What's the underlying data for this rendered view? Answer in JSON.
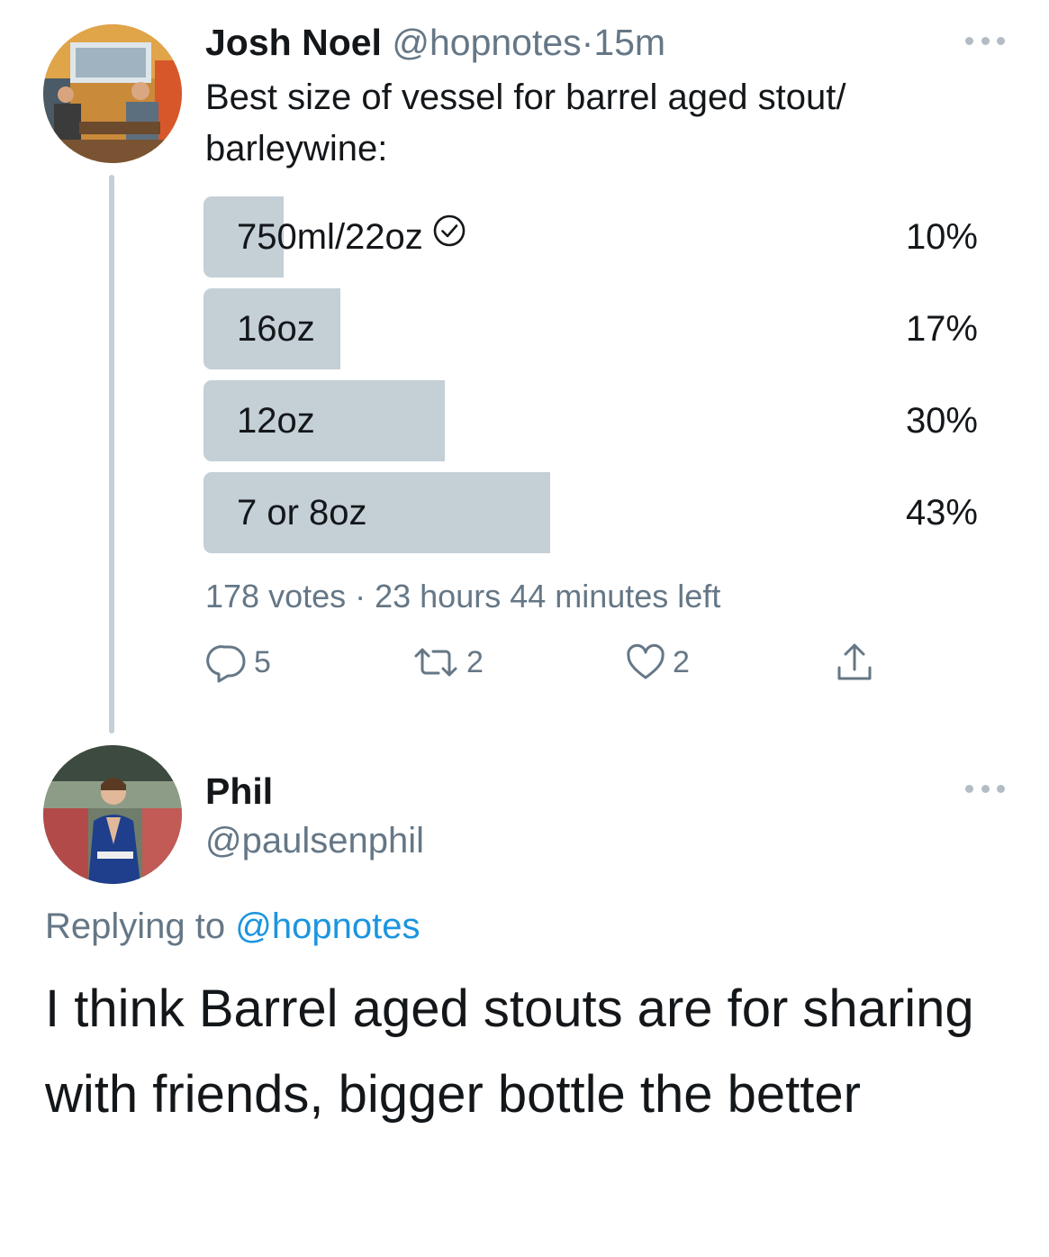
{
  "tweet": {
    "author_name": "Josh Noel",
    "author_handle": "@hopnotes",
    "separator": "·",
    "time": "15m",
    "text": "Best size of vessel for barrel aged stout/ barleywine:",
    "poll": {
      "options": [
        {
          "label": "750ml/22oz",
          "percent_text": "10%",
          "percent": 10,
          "voted": true
        },
        {
          "label": "16oz",
          "percent_text": "17%",
          "percent": 17,
          "voted": false
        },
        {
          "label": "12oz",
          "percent_text": "30%",
          "percent": 30,
          "voted": false
        },
        {
          "label": "7 or 8oz",
          "percent_text": "43%",
          "percent": 43,
          "voted": false
        }
      ],
      "meta": "178 votes · 23 hours 44 minutes left"
    },
    "actions": {
      "reply_count": "5",
      "retweet_count": "2",
      "like_count": "2"
    }
  },
  "reply": {
    "author_name": "Phil",
    "author_handle": "@paulsenphil",
    "replying_label": "Replying to",
    "replying_to": "@hopnotes",
    "text": "I think Barrel aged stouts are for sharing with friends, bigger bottle the better"
  },
  "colors": {
    "poll_bar": "#c4cfd6",
    "secondary_text": "#657786",
    "link": "#1b95e0"
  },
  "icons": [
    "more-icon",
    "check-circle-icon",
    "reply-icon",
    "retweet-icon",
    "like-icon",
    "share-icon"
  ]
}
